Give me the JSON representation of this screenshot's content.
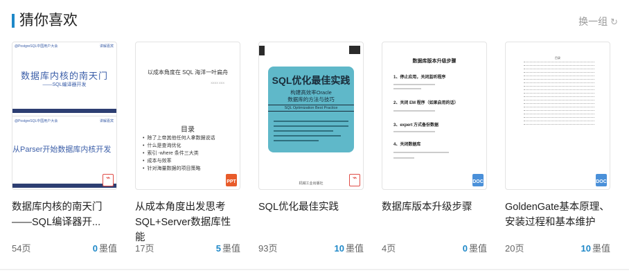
{
  "header": {
    "title": "猜你喜欢",
    "refresh_label": "换一组",
    "refresh_icon": "refresh-icon"
  },
  "cards": [
    {
      "title": "数据库内核的南天门——SQL编译器开...",
      "pages": "54页",
      "price_value": "0",
      "price_unit": "墨值",
      "file_type": "PPT",
      "thumb": {
        "head_left": "@PostgreSQL中国用户大会",
        "head_right": "讲解嘉宾",
        "big1": "数据库内核的南天门",
        "sub1": "——SQL编译器开发",
        "big2": "从Parser开始数据库内核开发"
      }
    },
    {
      "title": "从成本角度出发思考SQL+Server数据库性能",
      "pages": "17页",
      "price_value": "5",
      "price_unit": "墨值",
      "file_type": "PPT",
      "thumb": {
        "title": "以成本角度在 SQL 海洋一叶扁舟",
        "author": "XXXX XXX",
        "heading": "目录",
        "items": [
          "除了上帝其他任何人拿数据说话",
          "什么是查询优化",
          "索引 -where 条件三大类",
          "成本与效率",
          "针对海量数据的项目策略"
        ]
      }
    },
    {
      "title": "SQL优化最佳实践",
      "pages": "93页",
      "price_value": "10",
      "price_unit": "墨值",
      "file_type": "PDF",
      "thumb": {
        "title": "SQL优化最佳实践",
        "sub1": "构建高效率Oracle",
        "sub2": "数据库的方法与技巧",
        "en": "SQL Optimization Best Practice",
        "publisher": "机械工业出版社"
      }
    },
    {
      "title": "数据库版本升级步骤",
      "pages": "4页",
      "price_value": "0",
      "price_unit": "墨值",
      "file_type": "DOC",
      "thumb": {
        "title": "数据库版本升级步骤",
        "steps": [
          "1、停止应用，关闭监听程序",
          "2、关闭 EM 程序（如果启用的话）",
          "3、expert 方式备份数据",
          "4、关闭数据库"
        ]
      }
    },
    {
      "title": "GoldenGate基本原理、安装过程和基本维护",
      "pages": "20页",
      "price_value": "10",
      "price_unit": "墨值",
      "file_type": "DOC",
      "thumb": {
        "title": "目录"
      }
    }
  ]
}
